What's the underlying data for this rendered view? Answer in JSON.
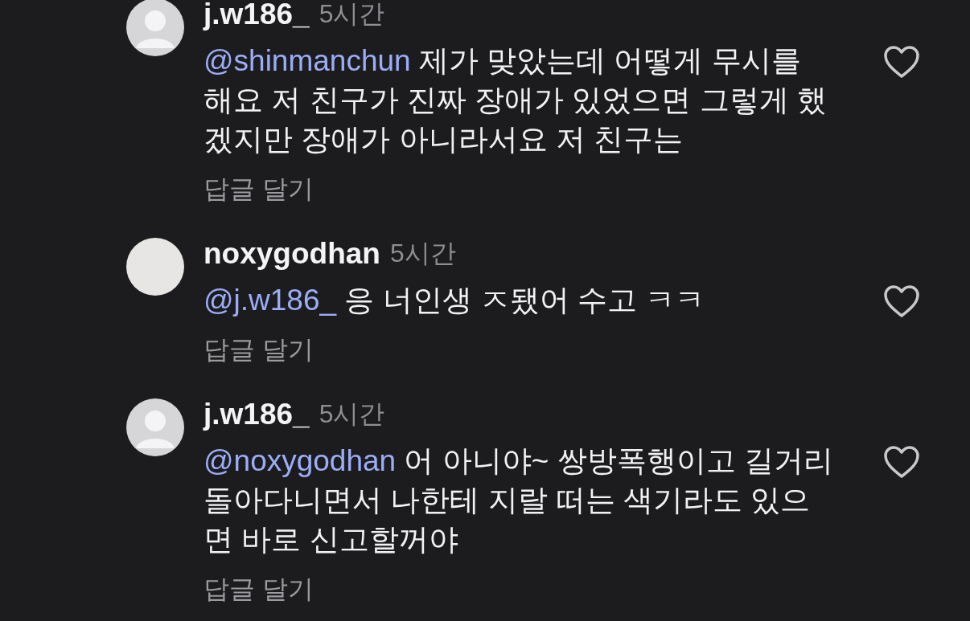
{
  "comments": [
    {
      "username": "j.w186_",
      "time": "5시간",
      "kind": "default",
      "mention": "@shinmanchun",
      "text": " 제가 맞았는데 어떻게 무시를 해요 저 친구가 진짜 장애가 있었으면 그렇게 했겠지만 장애가 아니라서요 저 친구는",
      "reply": "답글 달기",
      "liked": false
    },
    {
      "username": "noxygodhan",
      "time": "5시간",
      "kind": "photo",
      "mention": "@j.w186_",
      "text": " 응 너인생 ㅈ됐어 수고 ㅋㅋ",
      "reply": "답글 달기",
      "liked": false
    },
    {
      "username": "j.w186_",
      "time": "5시간",
      "kind": "default",
      "mention": "@noxygodhan",
      "text": " 어 아니야~ 쌍방폭행이고 길거리 돌아다니면서 나한테 지랄 떠는 색기라도 있으면 바로 신고할꺼야",
      "reply": "답글 달기",
      "liked": false
    }
  ]
}
